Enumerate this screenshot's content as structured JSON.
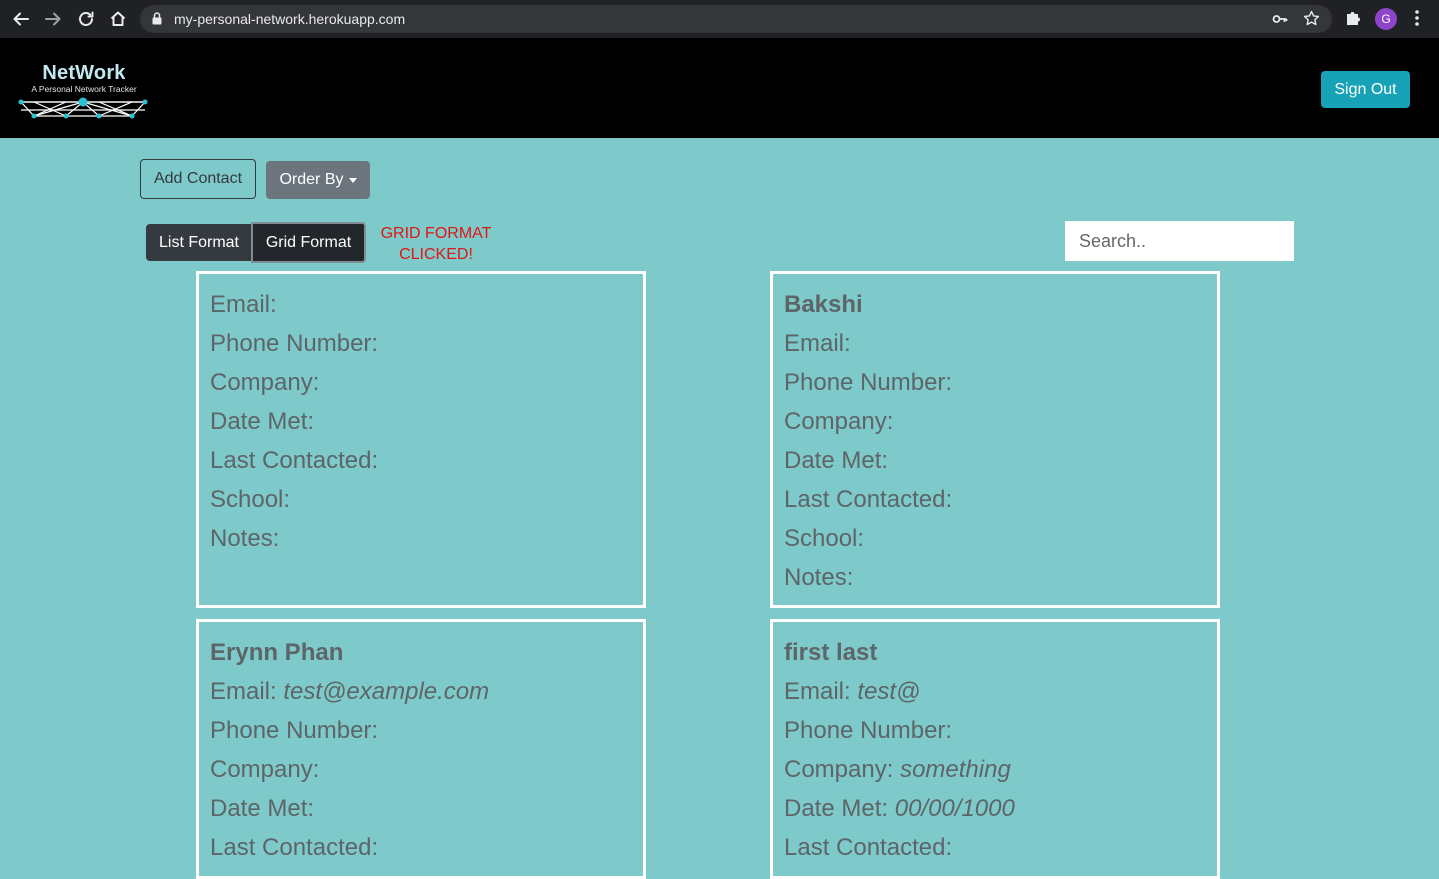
{
  "browser": {
    "url": "my-personal-network.herokuapp.com",
    "profile_initial": "G"
  },
  "header": {
    "logo_title": "NetWork",
    "logo_subtitle": "A Personal Network Tracker",
    "sign_out_label": "Sign Out"
  },
  "toolbar": {
    "add_contact_label": "Add Contact",
    "order_by_label": "Order By",
    "list_format_label": "List Format",
    "grid_format_label": "Grid Format",
    "clicked_message_line1": "GRID FORMAT",
    "clicked_message_line2": "CLICKED!",
    "search_placeholder": "Search.."
  },
  "labels": {
    "email": "Email:",
    "phone": "Phone Number:",
    "company": "Company:",
    "date_met": "Date Met:",
    "last_contacted": "Last Contacted:",
    "school": "School:",
    "notes": "Notes:"
  },
  "contacts": [
    {
      "name": "",
      "email": "",
      "phone": "",
      "company": "",
      "date_met": "",
      "last_contacted": "",
      "school": "",
      "notes": ""
    },
    {
      "name": "Bakshi",
      "email": "",
      "phone": "",
      "company": "",
      "date_met": "",
      "last_contacted": "",
      "school": "",
      "notes": ""
    },
    {
      "name": "Erynn Phan",
      "email": "test@example.com",
      "phone": "",
      "company": "",
      "date_met": "",
      "last_contacted": ""
    },
    {
      "name": "first last",
      "email": "test@",
      "phone": "",
      "company": "something",
      "date_met": "00/00/1000",
      "last_contacted": ""
    }
  ],
  "colors": {
    "page_background": "#7ecaca",
    "header_background": "#000000",
    "sign_out_button": "#17a2b8",
    "clicked_message": "#e01515",
    "card_border": "#ffffff"
  }
}
